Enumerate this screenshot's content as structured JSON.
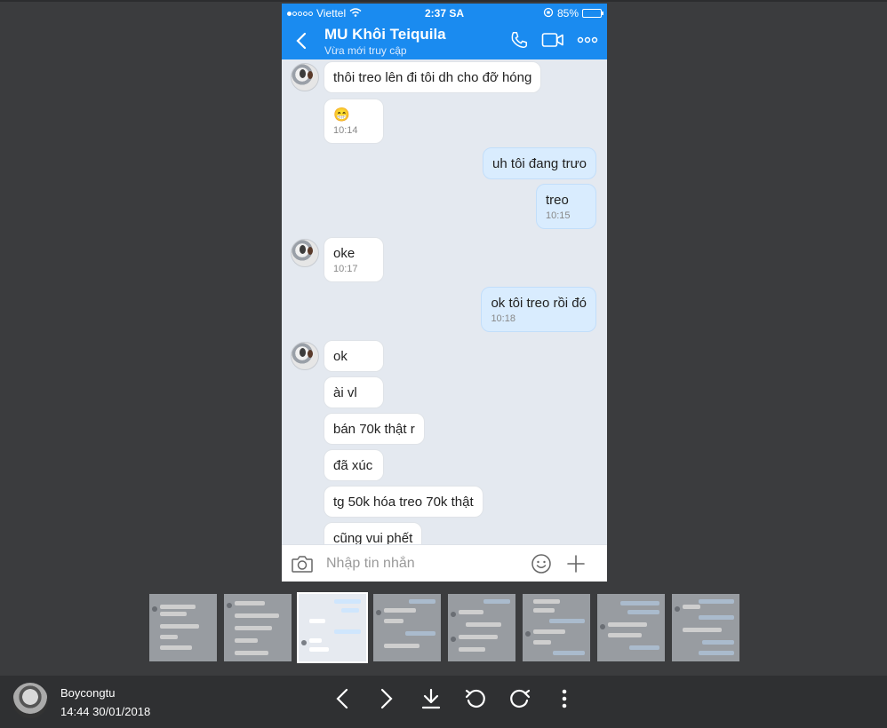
{
  "status_bar": {
    "carrier": "Viettel",
    "time": "2:37 SA",
    "battery": "85%",
    "battery_level": 0.85
  },
  "chat_header": {
    "contact_name": "MU Khôi Teiquila",
    "presence": "Vừa mới truy cập"
  },
  "messages": [
    {
      "side": "in",
      "text": "thôi treo lên đi tôi dh cho đỡ hóng",
      "time": ""
    },
    {
      "side": "in",
      "text": "😁",
      "time": "10:14"
    },
    {
      "side": "out",
      "text": "uh tôi đang trưo",
      "time": ""
    },
    {
      "side": "out",
      "text": "treo",
      "time": "10:15"
    },
    {
      "side": "in",
      "text": "oke",
      "time": "10:17"
    },
    {
      "side": "out",
      "text": "ok tôi treo rồi đó",
      "time": "10:18"
    },
    {
      "side": "in",
      "text": "ok",
      "time": ""
    },
    {
      "side": "in",
      "text": "ài vl",
      "time": ""
    },
    {
      "side": "in",
      "text": "bán 70k thật r",
      "time": ""
    },
    {
      "side": "in",
      "text": "đã xúc",
      "time": ""
    },
    {
      "side": "in",
      "text": "tg 50k hóa treo 70k thật",
      "time": ""
    },
    {
      "side": "in",
      "text": "cũng vui phết",
      "time": ""
    }
  ],
  "composer": {
    "placeholder": "Nhập tin nhắn"
  },
  "viewer": {
    "uploader_name": "Boycongtu",
    "upload_time": "14:44 30/01/2018",
    "thumbnail_count": 8,
    "active_thumbnail": 3
  },
  "icons": {
    "back": "chevron-left-icon",
    "call": "phone-icon",
    "video": "video-camera-icon",
    "more": "more-dots-icon",
    "camera": "camera-icon",
    "emoji": "smiley-icon",
    "add": "plus-icon",
    "prev": "chevron-left-icon",
    "next": "chevron-right-icon",
    "download": "download-icon",
    "rotate_left": "rotate-left-icon",
    "rotate_right": "rotate-right-icon",
    "options": "vertical-dots-icon"
  },
  "colors": {
    "header_blue": "#1a8bf0",
    "outgoing_bubble": "#d9ecfe",
    "incoming_bubble": "#ffffff",
    "chat_background": "#e4e9f0",
    "viewer_background": "#3b3c3e"
  }
}
